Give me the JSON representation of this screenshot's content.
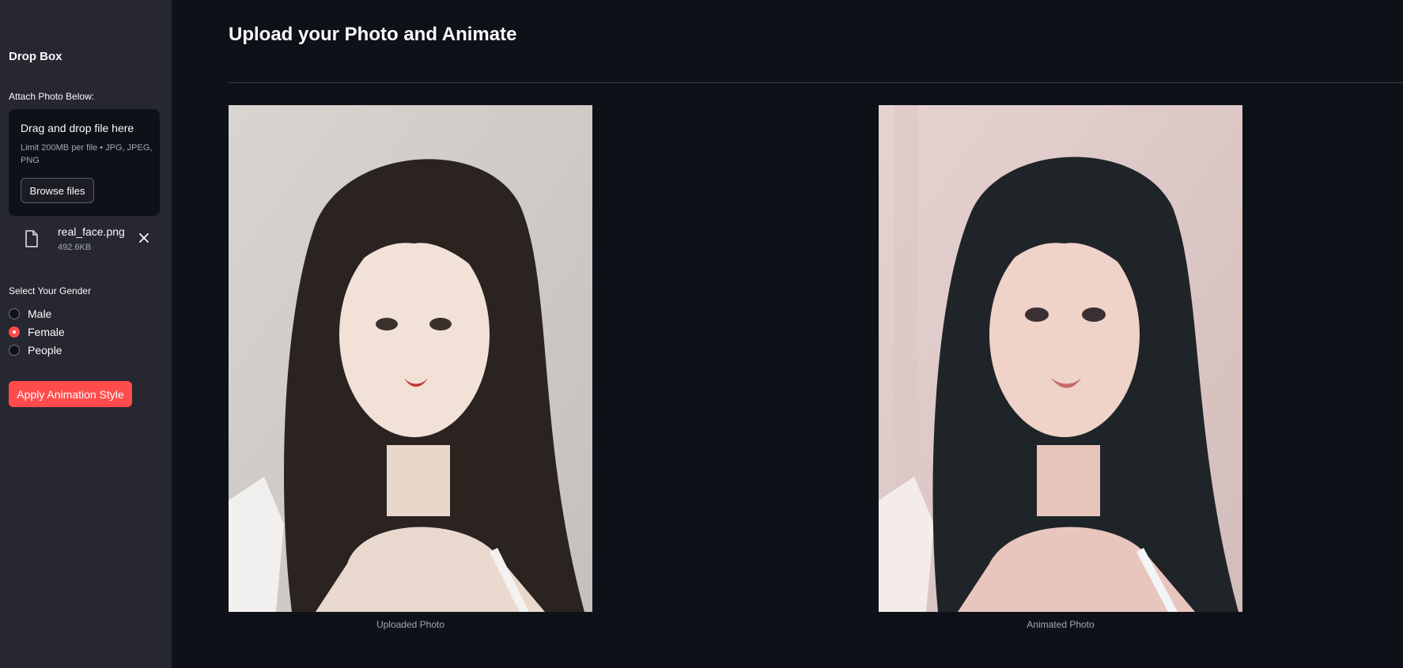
{
  "sidebar": {
    "title": "Drop Box",
    "attach_label": "Attach Photo Below:",
    "uploader": {
      "title": "Drag and drop file here",
      "limit": "Limit 200MB per file • JPG, JPEG, PNG",
      "browse_label": "Browse files"
    },
    "file": {
      "icon": "file-icon",
      "name": "real_face.png",
      "size": "492.6KB",
      "remove_icon": "close-icon"
    },
    "gender_label": "Select Your Gender",
    "gender_options": [
      {
        "label": "Male",
        "selected": false
      },
      {
        "label": "Female",
        "selected": true
      },
      {
        "label": "People",
        "selected": false
      }
    ],
    "apply_label": "Apply Animation Style"
  },
  "main": {
    "title": "Upload your Photo and Animate",
    "images": [
      {
        "caption": "Uploaded Photo"
      },
      {
        "caption": "Animated Photo"
      }
    ]
  },
  "colors": {
    "app_background": "#0e1117",
    "sidebar_background": "#262730",
    "accent": "#ff4b4b",
    "text": "#fafafa",
    "muted_text": "#a3a8b4"
  }
}
